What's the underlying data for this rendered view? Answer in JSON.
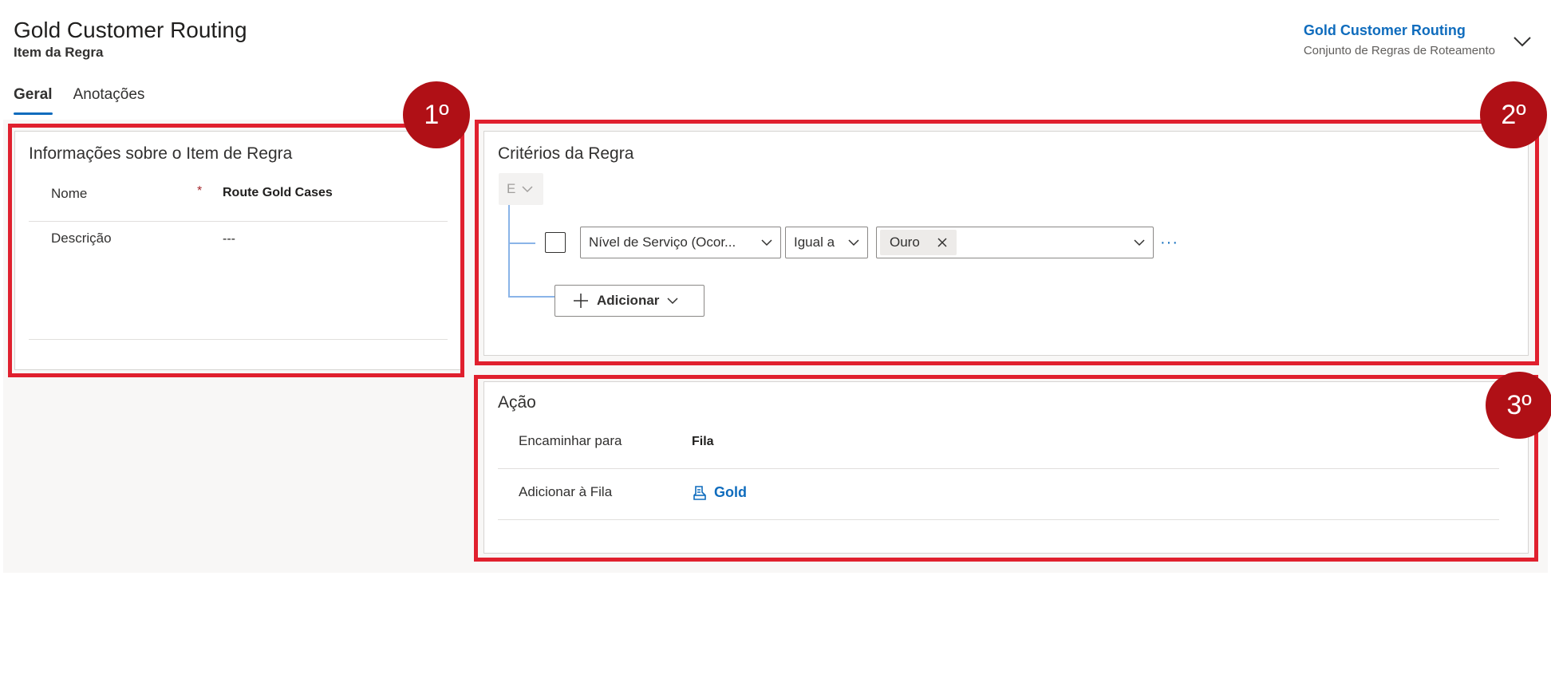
{
  "header": {
    "title": "Gold Customer Routing",
    "subtitle": "Item da Regra",
    "ruleset_name": "Gold Customer Routing",
    "ruleset_type": "Conjunto de Regras de Roteamento"
  },
  "tabs": [
    {
      "label": "Geral",
      "active": true
    },
    {
      "label": "Anotações",
      "active": false
    }
  ],
  "info_section": {
    "title": "Informações sobre o Item de Regra",
    "name_label": "Nome",
    "required_marker": "*",
    "name_value": "Route Gold Cases",
    "description_label": "Descrição",
    "description_value": "---"
  },
  "criteria_section": {
    "title": "Critérios da Regra",
    "group_operator": "E",
    "field": "Nível de Serviço (Ocor...",
    "operator": "Igual a",
    "value_chip": "Ouro",
    "more_label": "···",
    "add_label": "Adicionar"
  },
  "action_section": {
    "title": "Ação",
    "route_label": "Encaminhar para",
    "route_value": "Fila",
    "queue_label": "Adicionar à Fila",
    "queue_value": "Gold"
  },
  "annotations": {
    "badge1": "1º",
    "badge2": "2º",
    "badge3": "3º"
  },
  "colors": {
    "accent": "#0f6cbd",
    "annotation_red": "#e0202e",
    "badge_red": "#b01016"
  }
}
